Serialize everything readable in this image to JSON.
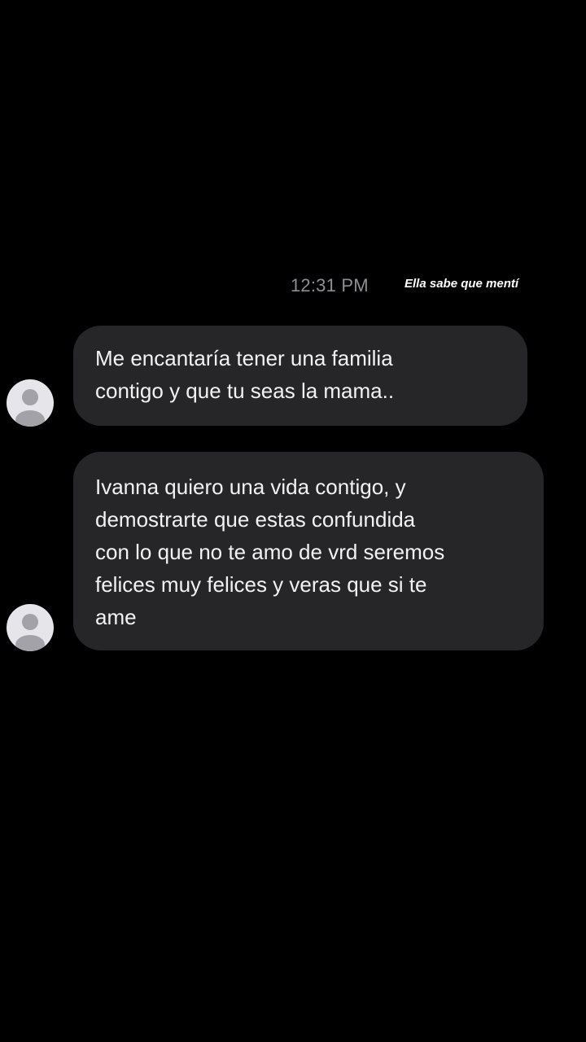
{
  "thread": {
    "timestamp": "12:31 PM",
    "caption": "Ella sabe que mentí"
  },
  "messages": [
    {
      "avatar_icon": "default-user-avatar-icon",
      "lines": [
        "Me encantaría tener una familia",
        "contigo y que tu seas la mama.."
      ]
    },
    {
      "avatar_icon": "default-user-avatar-icon",
      "lines": [
        "Ivanna quiero una vida contigo, y",
        "demostrarte que estas confundida",
        "con lo que no te amo de vrd seremos",
        "felices muy felices y veras que si te",
        "ame"
      ]
    }
  ],
  "colors": {
    "background": "#000000",
    "bubble": "#262628",
    "bubble_text": "#f2f2f2",
    "timestamp": "#8e8e93",
    "avatar_bg": "#e6e6ea",
    "avatar_figure": "#a2a2a8"
  }
}
